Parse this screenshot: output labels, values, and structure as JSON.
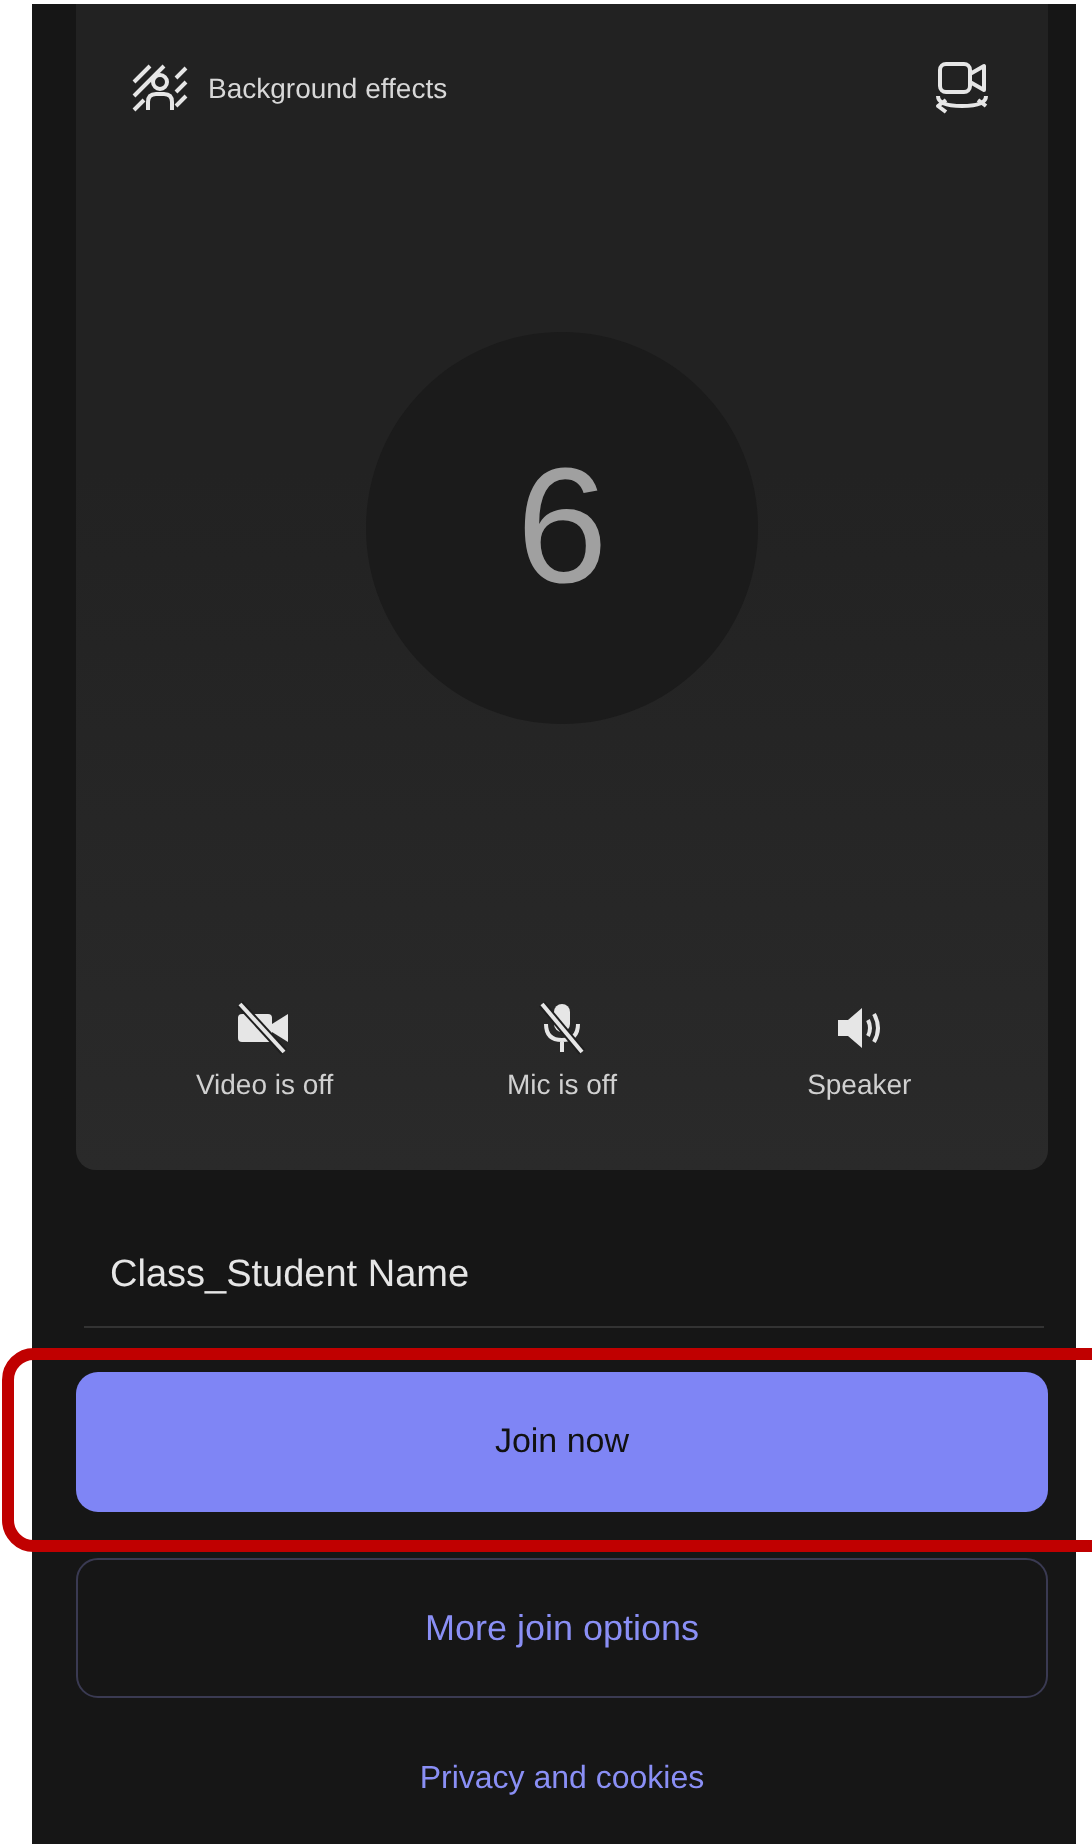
{
  "preview": {
    "background_effects": "Background effects",
    "countdown": "6",
    "controls": [
      {
        "kind": "video",
        "label": "Video is off",
        "on": false
      },
      {
        "kind": "mic",
        "label": "Mic is off",
        "on": false
      },
      {
        "kind": "speaker",
        "label": "Speaker",
        "on": true
      }
    ]
  },
  "name_field": {
    "value": "Class_Student Name"
  },
  "join_button": {
    "label": "Join now",
    "highlighted": true
  },
  "more_options": {
    "label": "More join options"
  },
  "privacy_link": {
    "label": "Privacy and cookies"
  }
}
